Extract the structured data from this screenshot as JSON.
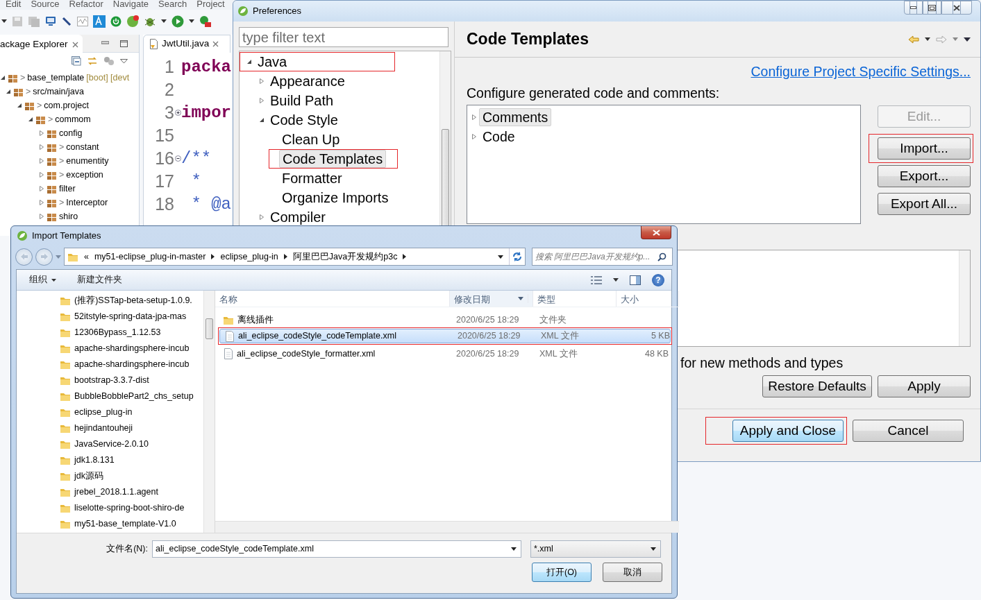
{
  "ide": {
    "menu": [
      "Edit",
      "Source",
      "Refactor",
      "Navigate",
      "Search",
      "Project"
    ],
    "explorer": {
      "title": "ackage Explorer",
      "tree": [
        {
          "label": "base_template",
          "prefix": ">",
          "suffix": "[boot] [devt",
          "expanded": true,
          "children": [
            {
              "label": "src/main/java",
              "prefix": ">",
              "expanded": true,
              "children": [
                {
                  "label": "com.project",
                  "prefix": ">",
                  "expanded": true,
                  "children": [
                    {
                      "label": "commom",
                      "prefix": ">",
                      "expanded": true,
                      "children": [
                        {
                          "label": "config",
                          "expanded": false
                        },
                        {
                          "label": "constant",
                          "prefix": ">",
                          "expanded": false
                        },
                        {
                          "label": "enumentity",
                          "prefix": ">",
                          "expanded": false
                        },
                        {
                          "label": "exception",
                          "prefix": ">",
                          "expanded": false
                        },
                        {
                          "label": "filter",
                          "expanded": false
                        },
                        {
                          "label": "Interceptor",
                          "prefix": ">",
                          "expanded": false
                        },
                        {
                          "label": "shiro",
                          "expanded": false
                        }
                      ]
                    }
                  ]
                }
              ]
            }
          ]
        }
      ]
    },
    "editor": {
      "tab": "JwtUtil.java",
      "lines": [
        {
          "number": "1",
          "code": "packa",
          "kind": "keyword"
        },
        {
          "number": "2"
        },
        {
          "number": "3",
          "code": "impor",
          "kind": "keyword",
          "collapsed": true
        },
        {
          "number": "15"
        },
        {
          "number": "16",
          "code": "/**",
          "kind": "comment",
          "collapsed": false
        },
        {
          "number": "17",
          "code": " *",
          "kind": "comment"
        },
        {
          "number": "18",
          "code": " * @a",
          "kind": "comment"
        }
      ]
    }
  },
  "preferences": {
    "title": "Preferences",
    "filter": {
      "placeholder": "type filter text"
    },
    "tree": [
      {
        "label": "Java",
        "expanded": true,
        "selected": false,
        "annotated": true,
        "children": [
          {
            "label": "Appearance",
            "expanded": false,
            "selected": false,
            "annotated": false
          },
          {
            "label": "Build Path",
            "expanded": false,
            "selected": false,
            "annotated": false
          },
          {
            "label": "Code Style",
            "expanded": true,
            "selected": false,
            "annotated": false,
            "children": [
              {
                "label": "Clean Up",
                "selected": false,
                "annotated": false
              },
              {
                "label": "Code Templates",
                "selected": true,
                "annotated": true
              },
              {
                "label": "Formatter",
                "selected": false,
                "annotated": false
              },
              {
                "label": "Organize Imports",
                "selected": false,
                "annotated": false
              }
            ]
          },
          {
            "label": "Compiler",
            "expanded": false,
            "selected": false,
            "annotated": false
          }
        ]
      }
    ],
    "page": {
      "title": "Code Templates",
      "link": "Configure Project Specific Settings...",
      "description": "Configure generated code and comments:",
      "templates": [
        {
          "label": "Comments",
          "expanded": false,
          "selected": true
        },
        {
          "label": "Code",
          "expanded": false,
          "selected": false
        }
      ],
      "side_buttons": [
        {
          "label": "Edit...",
          "disabled": true,
          "annotated": false
        },
        {
          "label": "Import...",
          "disabled": false,
          "annotated": true
        },
        {
          "label": "Export...",
          "disabled": false,
          "annotated": false
        },
        {
          "label": "Export All...",
          "disabled": false,
          "annotated": false
        }
      ],
      "option_text": "for new methods and types",
      "buttons": [
        {
          "label": "Restore Defaults",
          "annotated": false
        },
        {
          "label": "Apply",
          "annotated": false
        }
      ],
      "footer_buttons": [
        {
          "label": "Apply and Close",
          "default": true,
          "annotated": true
        },
        {
          "label": "Cancel",
          "default": false,
          "annotated": false
        }
      ]
    }
  },
  "import_dialog": {
    "title": "Import Templates",
    "breadcrumb": [
      "«",
      "my51-eclipse_plug-in-master",
      "eclipse_plug-in",
      "阿里巴巴Java开发规约p3c"
    ],
    "search": {
      "placeholder": "搜索 阿里巴巴Java开发规约p..."
    },
    "toolbar": [
      "组织",
      "新建文件夹"
    ],
    "help": "?",
    "folders": [
      {
        "name": "(推荐)SSTap-beta-setup-1.0.9.",
        "selected": false
      },
      {
        "name": "52itstyle-spring-data-jpa-mas",
        "selected": false
      },
      {
        "name": "12306Bypass_1.12.53",
        "selected": false
      },
      {
        "name": "apache-shardingsphere-incub",
        "selected": false
      },
      {
        "name": "apache-shardingsphere-incub",
        "selected": false
      },
      {
        "name": "bootstrap-3.3.7-dist",
        "selected": false
      },
      {
        "name": "BubbleBobblePart2_chs_setup",
        "selected": false
      },
      {
        "name": "eclipse_plug-in",
        "selected": false
      },
      {
        "name": "hejindantouheji",
        "selected": false
      },
      {
        "name": "JavaService-2.0.10",
        "selected": false
      },
      {
        "name": "jdk1.8.131",
        "selected": false
      },
      {
        "name": "jdk源码",
        "selected": false
      },
      {
        "name": "jrebel_2018.1.1.agent",
        "selected": false
      },
      {
        "name": "liselotte-spring-boot-shiro-de",
        "selected": false
      },
      {
        "name": "my51-base_template-V1.0",
        "selected": false
      }
    ],
    "columns": [
      "名称",
      "修改日期",
      "类型",
      "大小"
    ],
    "files": [
      {
        "kind": "folder",
        "name": "离线插件",
        "date": "2020/6/25 18:29",
        "type": "文件夹",
        "selected": false,
        "annotated": false
      },
      {
        "kind": "file",
        "name": "ali_eclipse_codeStyle_codeTemplate.xml",
        "date": "2020/6/25 18:29",
        "type": "XML 文件",
        "size": "5 KB",
        "selected": true,
        "annotated": true
      },
      {
        "kind": "file",
        "name": "ali_eclipse_codeStyle_formatter.xml",
        "date": "2020/6/25 18:29",
        "type": "XML 文件",
        "size": "48 KB",
        "selected": false,
        "annotated": false
      }
    ],
    "filename": {
      "label": "文件名(N):",
      "value": "ali_eclipse_codeStyle_codeTemplate.xml"
    },
    "filter": {
      "value": "*.xml"
    },
    "buttons": [
      {
        "label": "打开(O)",
        "default": true
      },
      {
        "label": "取消",
        "default": false
      }
    ]
  }
}
